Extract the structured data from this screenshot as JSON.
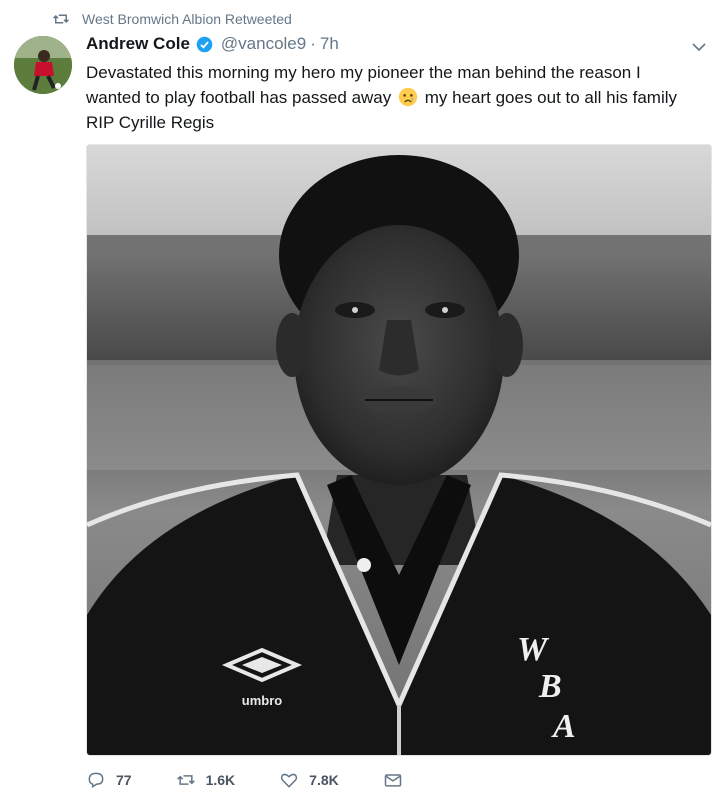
{
  "retweet": {
    "text": "West Bromwich Albion Retweeted",
    "icon": "retweet-icon"
  },
  "author": {
    "name": "Andrew Cole",
    "handle": "@vancole9",
    "separator": "·",
    "time": "7h",
    "verified": true
  },
  "tweet": {
    "text_part1": "Devastated this morning my hero my pioneer the man behind the reason I wanted to play football has passed away",
    "emoji": "crying-face",
    "text_part2": "my heart goes out to all his family RIP Cyrille Regis"
  },
  "photo": {
    "description_badge": "",
    "shirt_crest": [
      "W",
      "B",
      "A"
    ],
    "shirt_brand": "umbro"
  },
  "actions": {
    "replies": "77",
    "retweets": "1.6K",
    "likes": "7.8K"
  },
  "colors": {
    "accent": "#1da1f2",
    "muted": "#657786",
    "text": "#14171a"
  }
}
